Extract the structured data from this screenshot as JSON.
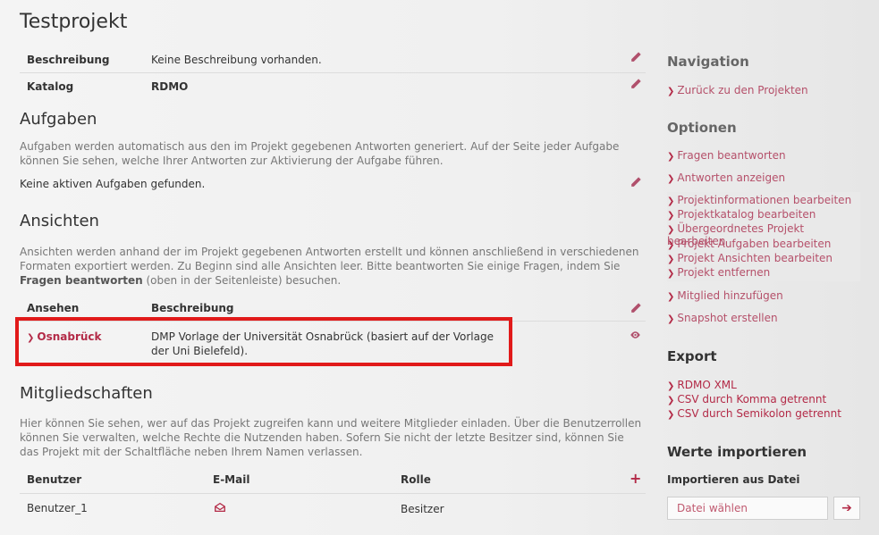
{
  "project": {
    "title": "Testprojekt"
  },
  "info": {
    "rows": [
      {
        "label": "Beschreibung",
        "value": "Keine Beschreibung vorhanden."
      },
      {
        "label": "Katalog",
        "value": "RDMO"
      }
    ]
  },
  "tasks": {
    "title": "Aufgaben",
    "desc": "Aufgaben werden automatisch aus den im Projekt gegebenen Antworten generiert. Auf der Seite jeder Aufgabe können Sie sehen, welche Ihrer Antworten zur Aktivierung der Aufgabe führen.",
    "empty": "Keine aktiven Aufgaben gefunden."
  },
  "views": {
    "title": "Ansichten",
    "desc_pre": "Ansichten werden anhand der im Projekt gegebenen Antworten erstellt und können anschließend in verschiedenen Formaten exportiert werden. Zu Beginn sind alle Ansichten leer. Bitte beantworten Sie einige Fragen, indem Sie ",
    "desc_bold": "Fragen beantworten",
    "desc_post": " (oben in der Seitenleiste) besuchen.",
    "col_view": "Ansehen",
    "col_desc": "Beschreibung",
    "items": [
      {
        "name": "Osnabrück",
        "description": "DMP Vorlage der Universität Osnabrück (basiert auf der Vorlage der Uni Bielefeld)."
      }
    ]
  },
  "memberships": {
    "title": "Mitgliedschaften",
    "desc": "Hier können Sie sehen, wer auf das Projekt zugreifen kann und weitere Mitglieder einladen. Über die Benutzerrollen können Sie verwalten, welche Rechte die Nutzenden haben. Sofern Sie nicht der letzte Besitzer sind, können Sie das Projekt mit der Schaltfläche neben Ihrem Namen verlassen.",
    "col_user": "Benutzer",
    "col_email": "E-Mail",
    "col_role": "Rolle",
    "rows": [
      {
        "user": "Benutzer_1",
        "role": "Besitzer"
      }
    ]
  },
  "sidebar": {
    "nav_title": "Navigation",
    "back": "Zurück zu den Projekten",
    "options_title": "Optionen",
    "answer": "Fragen beantworten",
    "show_answers": "Antworten anzeigen",
    "edit_group": [
      "Projektinformationen bearbeiten",
      "Projektkatalog bearbeiten",
      "Übergeordnetes Projekt bearbeiten",
      "Projekt Aufgaben bearbeiten",
      "Projekt Ansichten bearbeiten",
      "Projekt entfernen"
    ],
    "add_member": "Mitglied hinzufügen",
    "snapshot": "Snapshot erstellen",
    "export_title": "Export",
    "export": [
      "RDMO XML",
      "CSV durch Komma getrennt",
      "CSV durch Semikolon getrennt"
    ],
    "import_title": "Werte importieren",
    "import_from_file": "Importieren aus Datei",
    "choose_file": "Datei wählen"
  },
  "colors": {
    "accent": "#b32a47",
    "highlight": "#e11a1a"
  }
}
